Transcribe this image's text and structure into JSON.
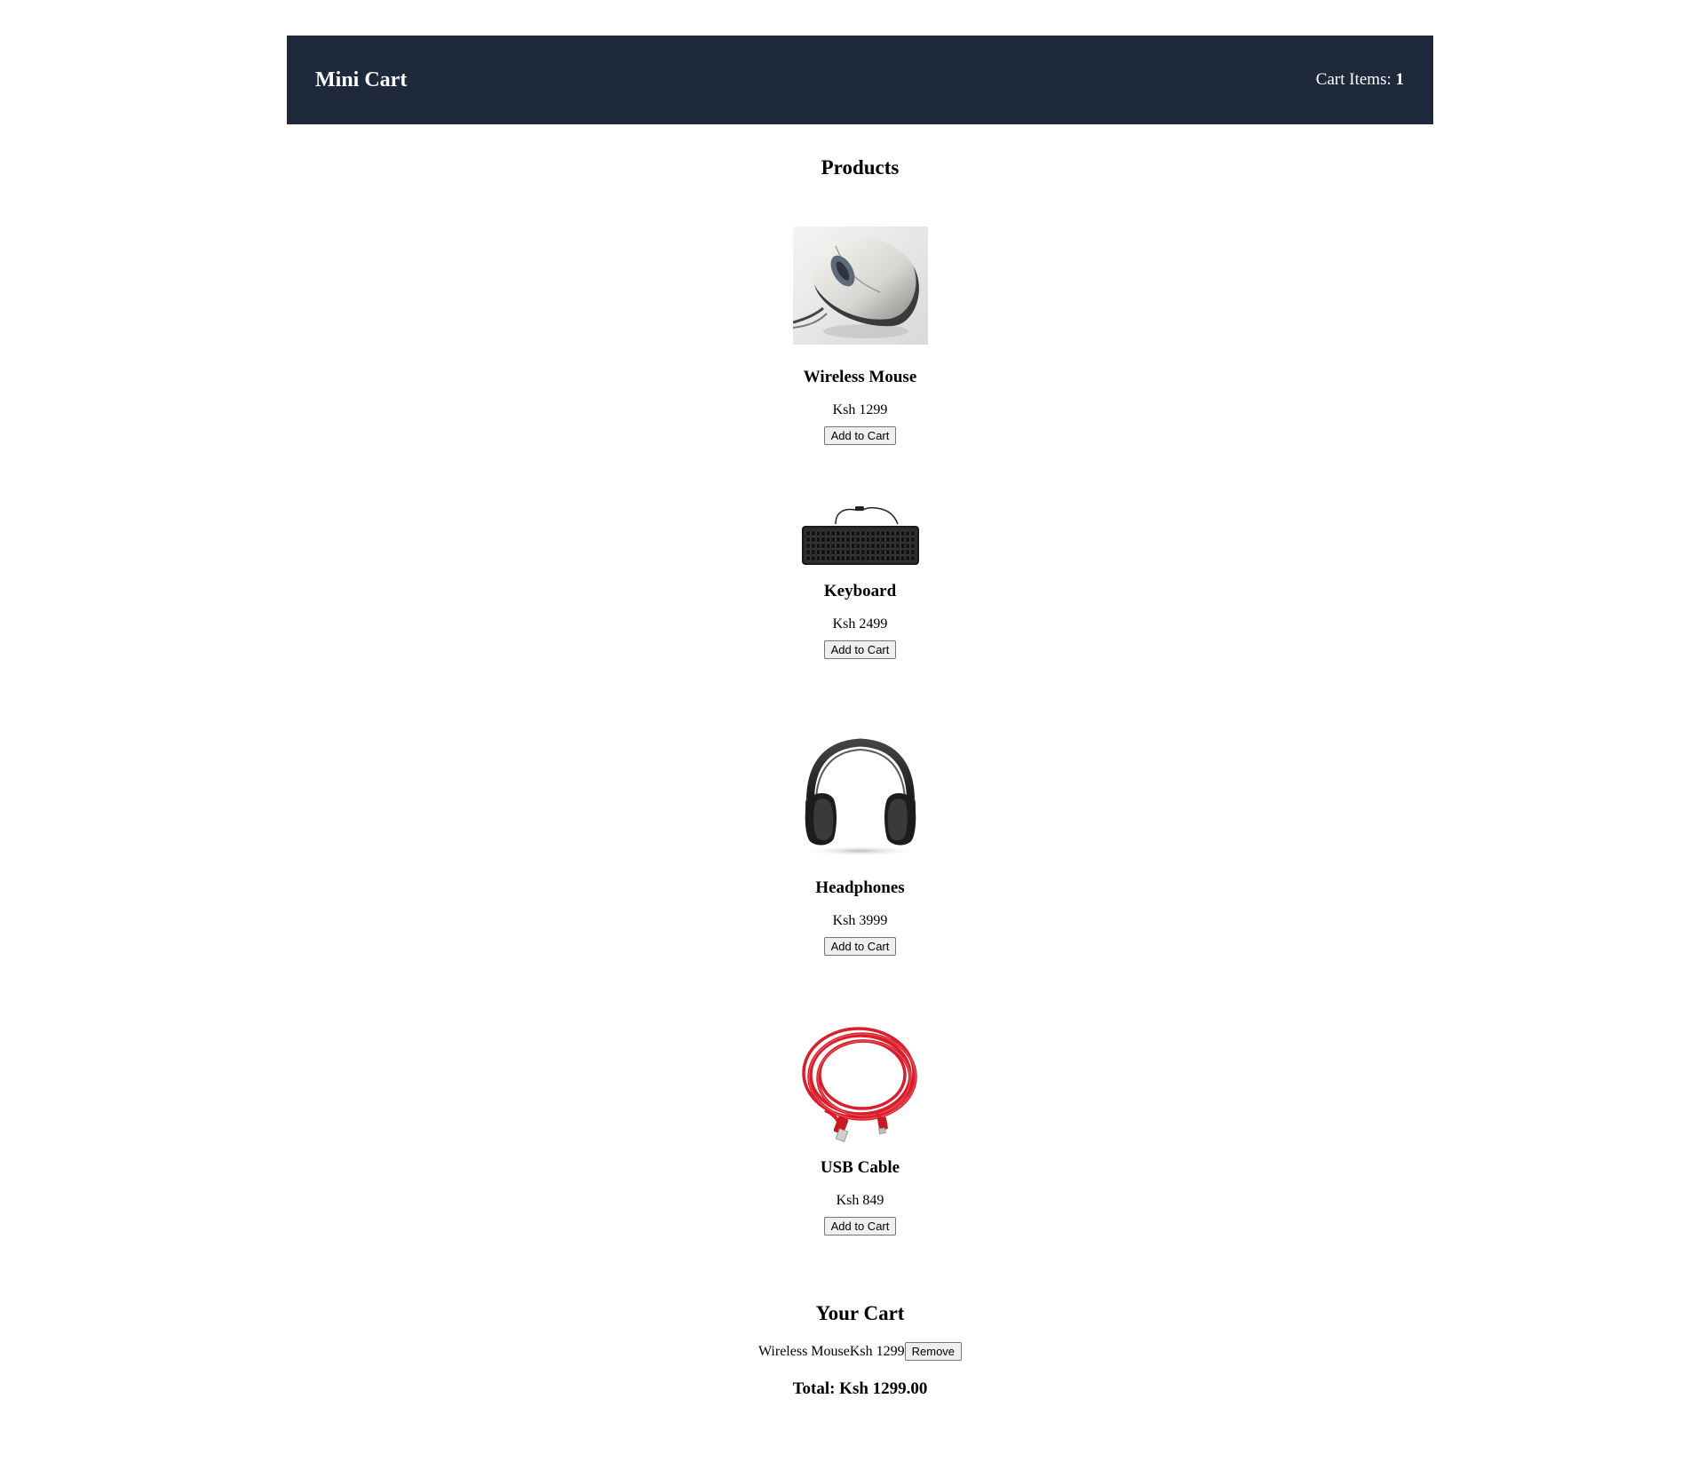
{
  "header": {
    "brand": "Mini Cart",
    "cart_items_label": "Cart Items: ",
    "cart_items_count": "1",
    "background_color": "#1e293b"
  },
  "products_section": {
    "title": "Products",
    "items": [
      {
        "name": "Wireless Mouse",
        "price": "Ksh 1299",
        "button_label": "Add to Cart",
        "image": "mouse-photo"
      },
      {
        "name": "Keyboard",
        "price": "Ksh 2499",
        "button_label": "Add to Cart",
        "image": "keyboard-photo"
      },
      {
        "name": "Headphones",
        "price": "Ksh 3999",
        "button_label": "Add to Cart",
        "image": "headphones-photo"
      },
      {
        "name": "USB Cable",
        "price": "Ksh 849",
        "button_label": "Add to Cart",
        "image": "usb-cable-photo"
      }
    ]
  },
  "cart_section": {
    "title": "Your Cart",
    "items": [
      {
        "name": "Wireless Mouse",
        "price": "Ksh 1299",
        "remove_label": "Remove"
      }
    ],
    "total": "Total: Ksh 1299.00"
  }
}
